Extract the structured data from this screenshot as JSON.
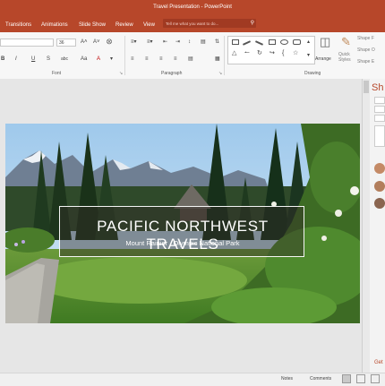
{
  "window": {
    "title": "Travel Presentation - PowerPoint"
  },
  "tabs": [
    "Transitions",
    "Animations",
    "Slide Show",
    "Review",
    "View"
  ],
  "search": {
    "placeholder": "Tell me what you want to do..."
  },
  "ribbon": {
    "font_size": "36",
    "groups": {
      "font": "Font",
      "paragraph": "Paragraph",
      "drawing": "Drawing"
    },
    "arrange": "Arrange",
    "quick_styles": "Quick\nStyles",
    "shape_fill": "Shape F",
    "shape_outline": "Shape O",
    "shape_effects": "Shape E",
    "bold": "B",
    "italic": "I",
    "underline": "U",
    "strike": "S",
    "char_spacing": "abc"
  },
  "slide": {
    "title": "PACIFIC NORTHWEST TRAVELS",
    "subtitle": "Mount Rainier , Olympic National Park"
  },
  "share_pane": {
    "title": "Sh",
    "get_link": "Get"
  },
  "status": {
    "notes": "Notes",
    "comments": "Comments"
  },
  "colors": {
    "accent": "#b7472a",
    "ribbon": "#f7f7f7"
  }
}
